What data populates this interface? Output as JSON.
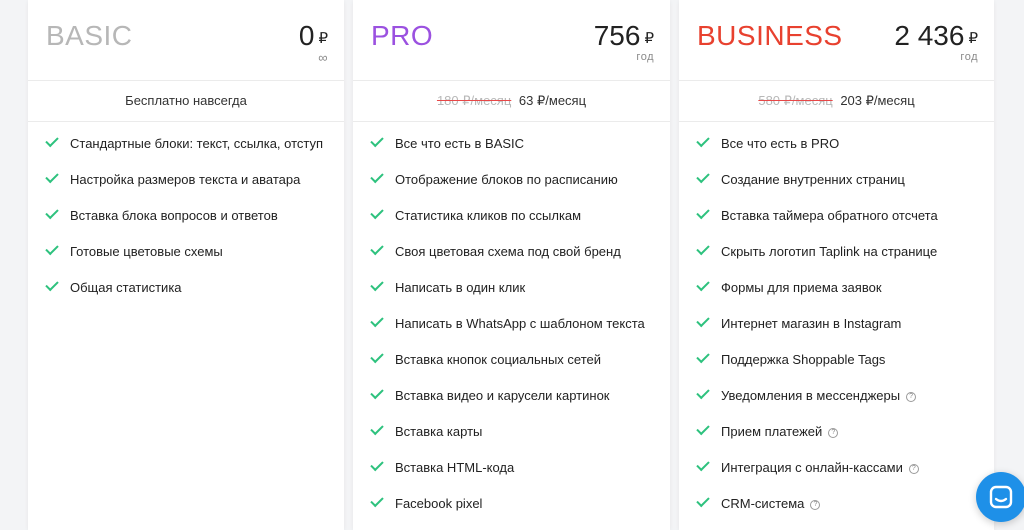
{
  "plans": [
    {
      "name": "BASIC",
      "name_color": "#b7b7b7",
      "price": "0",
      "currency": "₽",
      "period": "∞",
      "old_monthly": "",
      "subtitle": "Бесплатно навсегда",
      "features": [
        {
          "text": "Стандартные блоки: текст, ссылка, отступ",
          "help": false
        },
        {
          "text": "Настройка размеров текста и аватара",
          "help": false
        },
        {
          "text": "Вставка блока вопросов и ответов",
          "help": false
        },
        {
          "text": "Готовые цветовые схемы",
          "help": false
        },
        {
          "text": "Общая статистика",
          "help": false
        }
      ]
    },
    {
      "name": "PRO",
      "name_color": "#9b51e0",
      "price": "756",
      "currency": "₽",
      "period": "год",
      "old_monthly": "180 ₽/месяц",
      "subtitle": "63 ₽/месяц",
      "features": [
        {
          "text": "Все что есть в BASIC",
          "help": false
        },
        {
          "text": "Отображение блоков по расписанию",
          "help": false
        },
        {
          "text": "Статистика кликов по ссылкам",
          "help": false
        },
        {
          "text": "Своя цветовая схема под свой бренд",
          "help": false
        },
        {
          "text": "Написать в один клик",
          "help": false
        },
        {
          "text": "Написать в WhatsApp с шаблоном текста",
          "help": false
        },
        {
          "text": "Вставка кнопок социальных сетей",
          "help": false
        },
        {
          "text": "Вставка видео и карусели картинок",
          "help": false
        },
        {
          "text": "Вставка карты",
          "help": false
        },
        {
          "text": "Вставка HTML-кода",
          "help": false
        },
        {
          "text": "Facebook pixel",
          "help": false
        }
      ]
    },
    {
      "name": "BUSINESS",
      "name_color": "#e8412f",
      "price": "2 436",
      "currency": "₽",
      "period": "год",
      "old_monthly": "580 ₽/месяц",
      "subtitle": "203 ₽/месяц",
      "features": [
        {
          "text": "Все что есть в PRO",
          "help": false
        },
        {
          "text": "Создание внутренних страниц",
          "help": false
        },
        {
          "text": "Вставка таймера обратного отсчета",
          "help": false
        },
        {
          "text": "Скрыть логотип Taplink на странице",
          "help": false
        },
        {
          "text": "Формы для приема заявок",
          "help": false
        },
        {
          "text": "Интернет магазин в Instagram",
          "help": false
        },
        {
          "text": "Поддержка Shoppable Tags",
          "help": false
        },
        {
          "text": "Уведомления в мессенджеры",
          "help": true
        },
        {
          "text": "Прием платежей",
          "help": true
        },
        {
          "text": "Интеграция с онлайн-кассами",
          "help": true
        },
        {
          "text": "CRM-система",
          "help": true
        }
      ]
    }
  ],
  "help_glyph": "?",
  "chat_widget": {
    "icon": "chat-icon",
    "color": "#1e90e8"
  },
  "colors": {
    "check": "#2ec27e",
    "strike": "#e84848"
  }
}
